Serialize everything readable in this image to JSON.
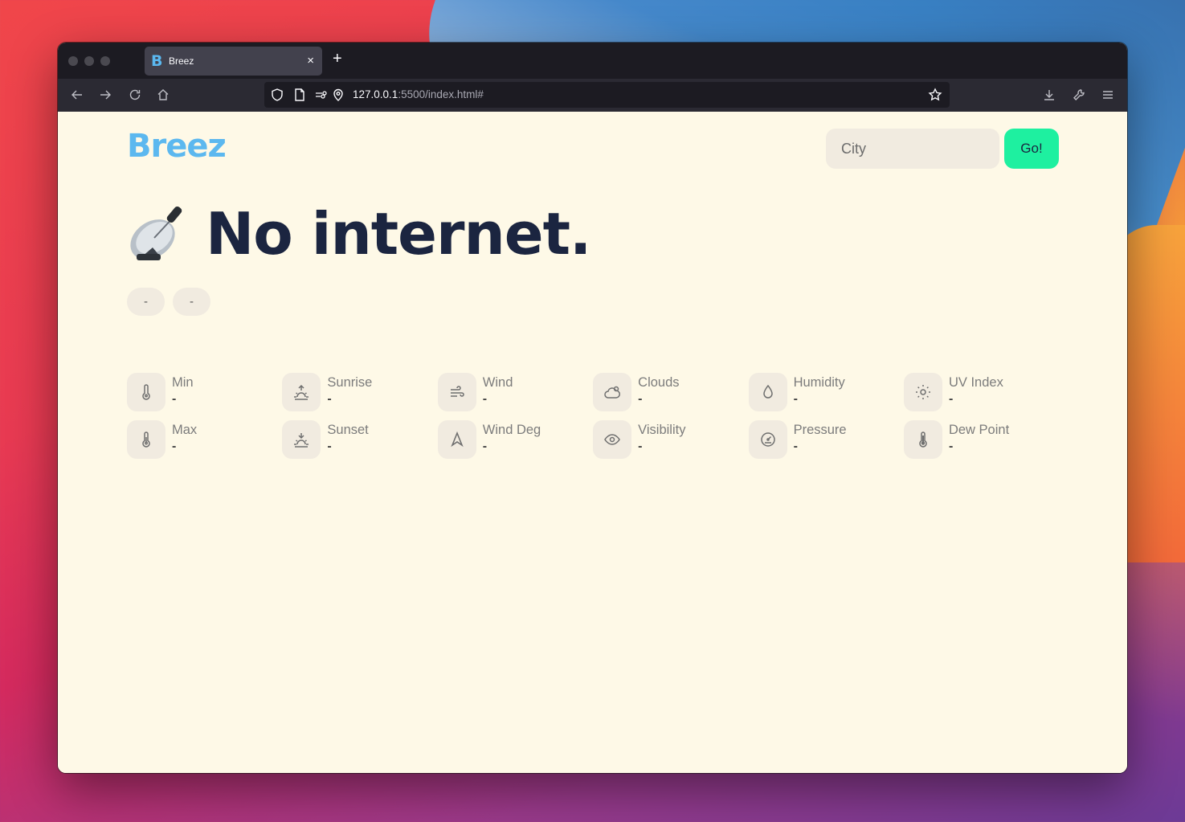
{
  "browser": {
    "tab_title": "Breez",
    "tab_favicon": "B",
    "new_tab_label": "+",
    "close_tab_label": "×",
    "url_host": "127.0.0.1",
    "url_rest": ":5500/index.html#"
  },
  "header": {
    "logo": "Breez",
    "city_placeholder": "City",
    "city_value": "",
    "go_label": "Go!"
  },
  "main": {
    "status_emoji": "📡",
    "headline": "No internet.",
    "pills": [
      "-",
      "-"
    ]
  },
  "stats": [
    {
      "label": "Min",
      "value": "-",
      "icon": "thermometer-icon"
    },
    {
      "label": "Sunrise",
      "value": "-",
      "icon": "sunrise-icon"
    },
    {
      "label": "Wind",
      "value": "-",
      "icon": "wind-icon"
    },
    {
      "label": "Clouds",
      "value": "-",
      "icon": "cloud-icon"
    },
    {
      "label": "Humidity",
      "value": "-",
      "icon": "droplet-icon"
    },
    {
      "label": "UV Index",
      "value": "-",
      "icon": "sun-icon"
    },
    {
      "label": "Max",
      "value": "-",
      "icon": "thermometer-icon"
    },
    {
      "label": "Sunset",
      "value": "-",
      "icon": "sunset-icon"
    },
    {
      "label": "Wind Deg",
      "value": "-",
      "icon": "navigation-arrow-icon"
    },
    {
      "label": "Visibility",
      "value": "-",
      "icon": "eye-icon"
    },
    {
      "label": "Pressure",
      "value": "-",
      "icon": "gauge-icon"
    },
    {
      "label": "Dew Point",
      "value": "-",
      "icon": "thermometer-full-icon"
    }
  ],
  "colors": {
    "page_bg": "#fef9e7",
    "logo": "#5cb8ef",
    "go_button": "#1ef0a0",
    "headline": "#1b2540"
  }
}
